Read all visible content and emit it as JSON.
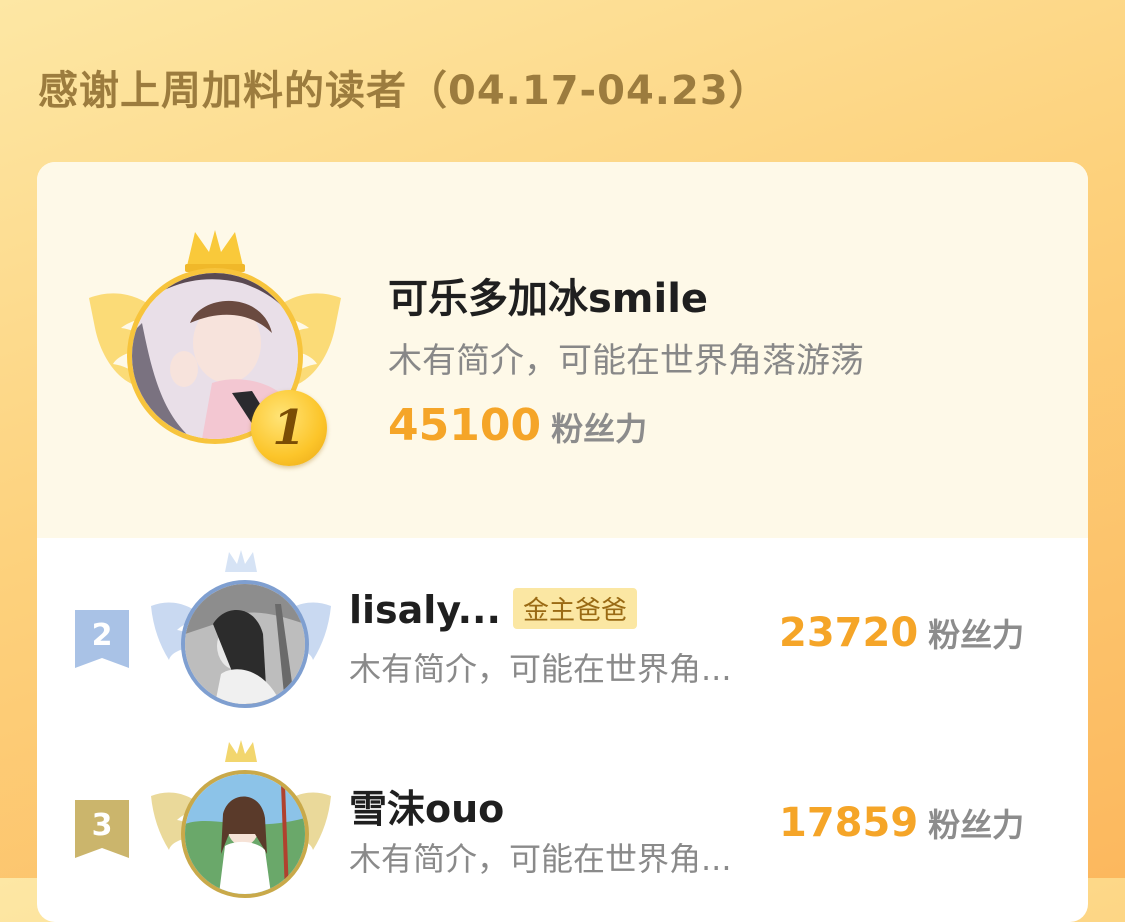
{
  "header": {
    "title": "感谢上周加料的读者（04.17-04.23）"
  },
  "points_unit": "粉丝力",
  "colors": {
    "background_gradient": [
      "#fde7a4",
      "#fcb85e"
    ],
    "title_text": "#9c7c3e",
    "points_number": "#f5a528",
    "gold": "#fcc52a",
    "silver_blue": "#8fb0dc",
    "bronze_olive": "#c9b36a"
  },
  "top_reader": {
    "rank": "1",
    "name": "可乐多加冰smile",
    "bio": "木有简介，可能在世界角落游荡",
    "points": "45100",
    "frame": "gold-crown-wings-frame"
  },
  "readers": [
    {
      "rank": "2",
      "name": "lisaly...",
      "badge": "金主爸爸",
      "bio": "木有简介，可能在世界角...",
      "points": "23720",
      "frame": "silver-crown-wings-frame"
    },
    {
      "rank": "3",
      "name": "雪沫ouo",
      "badge": "",
      "bio": "木有简介，可能在世界角...",
      "points": "17859",
      "frame": "bronze-crown-wings-frame"
    }
  ]
}
